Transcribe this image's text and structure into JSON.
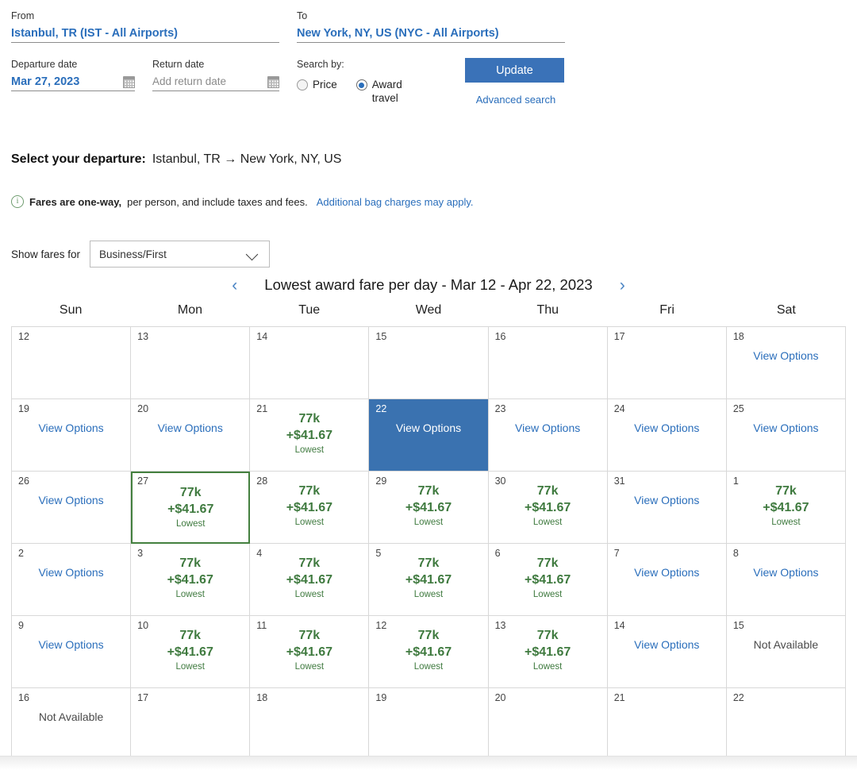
{
  "search": {
    "from_label": "From",
    "from_value": "Istanbul, TR (IST - All Airports)",
    "to_label": "To",
    "to_value": "New York, NY, US (NYC - All Airports)",
    "departure_label": "Departure date",
    "departure_value": "Mar 27, 2023",
    "return_label": "Return date",
    "return_placeholder": "Add return date",
    "search_by_label": "Search by:",
    "option_price": "Price",
    "option_award": "Award travel",
    "update_label": "Update",
    "advanced_search": "Advanced search"
  },
  "departure": {
    "heading": "Select your departure:",
    "route": "Istanbul, TR → New York, NY, US"
  },
  "note": {
    "bold": "Fares are one-way,",
    "rest": "per person, and include taxes and fees.",
    "link": "Additional bag charges may apply."
  },
  "fares_filter": {
    "label": "Show fares for",
    "selected": "Business/First"
  },
  "calendar": {
    "prev_arrow": "‹",
    "next_arrow": "›",
    "title": "Lowest award fare per day - Mar 12 - Apr 22, 2023",
    "weekdays": [
      "Sun",
      "Mon",
      "Tue",
      "Wed",
      "Thu",
      "Fri",
      "Sat"
    ],
    "labels": {
      "view_options": "View Options",
      "not_available": "Not Available",
      "lowest": "Lowest"
    },
    "colors": {
      "selected_bg": "#3a72b0",
      "chosen_border": "#44803f",
      "fare_green": "#3f7a3f",
      "link_blue": "#2a6ebb",
      "button_blue": "#3a72b8"
    },
    "cells": [
      {
        "day": "12",
        "state": "empty"
      },
      {
        "day": "13",
        "state": "empty"
      },
      {
        "day": "14",
        "state": "empty"
      },
      {
        "day": "15",
        "state": "empty"
      },
      {
        "day": "16",
        "state": "empty"
      },
      {
        "day": "17",
        "state": "empty"
      },
      {
        "day": "18",
        "state": "options"
      },
      {
        "day": "19",
        "state": "options"
      },
      {
        "day": "20",
        "state": "options"
      },
      {
        "day": "21",
        "state": "fare",
        "miles": "77k",
        "cash": "+$41.67",
        "tag": "Lowest"
      },
      {
        "day": "22",
        "state": "options",
        "selected": true
      },
      {
        "day": "23",
        "state": "options"
      },
      {
        "day": "24",
        "state": "options"
      },
      {
        "day": "25",
        "state": "options"
      },
      {
        "day": "26",
        "state": "options"
      },
      {
        "day": "27",
        "state": "fare",
        "miles": "77k",
        "cash": "+$41.67",
        "tag": "Lowest",
        "chosen": true
      },
      {
        "day": "28",
        "state": "fare",
        "miles": "77k",
        "cash": "+$41.67",
        "tag": "Lowest"
      },
      {
        "day": "29",
        "state": "fare",
        "miles": "77k",
        "cash": "+$41.67",
        "tag": "Lowest"
      },
      {
        "day": "30",
        "state": "fare",
        "miles": "77k",
        "cash": "+$41.67",
        "tag": "Lowest"
      },
      {
        "day": "31",
        "state": "options"
      },
      {
        "day": "1",
        "state": "fare",
        "miles": "77k",
        "cash": "+$41.67",
        "tag": "Lowest"
      },
      {
        "day": "2",
        "state": "options"
      },
      {
        "day": "3",
        "state": "fare",
        "miles": "77k",
        "cash": "+$41.67",
        "tag": "Lowest"
      },
      {
        "day": "4",
        "state": "fare",
        "miles": "77k",
        "cash": "+$41.67",
        "tag": "Lowest"
      },
      {
        "day": "5",
        "state": "fare",
        "miles": "77k",
        "cash": "+$41.67",
        "tag": "Lowest"
      },
      {
        "day": "6",
        "state": "fare",
        "miles": "77k",
        "cash": "+$41.67",
        "tag": "Lowest"
      },
      {
        "day": "7",
        "state": "options"
      },
      {
        "day": "8",
        "state": "options"
      },
      {
        "day": "9",
        "state": "options"
      },
      {
        "day": "10",
        "state": "fare",
        "miles": "77k",
        "cash": "+$41.67",
        "tag": "Lowest"
      },
      {
        "day": "11",
        "state": "fare",
        "miles": "77k",
        "cash": "+$41.67",
        "tag": "Lowest"
      },
      {
        "day": "12",
        "state": "fare",
        "miles": "77k",
        "cash": "+$41.67",
        "tag": "Lowest"
      },
      {
        "day": "13",
        "state": "fare",
        "miles": "77k",
        "cash": "+$41.67",
        "tag": "Lowest"
      },
      {
        "day": "14",
        "state": "options"
      },
      {
        "day": "15",
        "state": "unavailable"
      },
      {
        "day": "16",
        "state": "unavailable"
      },
      {
        "day": "17",
        "state": "empty"
      },
      {
        "day": "18",
        "state": "empty"
      },
      {
        "day": "19",
        "state": "empty"
      },
      {
        "day": "20",
        "state": "empty"
      },
      {
        "day": "21",
        "state": "empty"
      },
      {
        "day": "22",
        "state": "empty"
      }
    ]
  }
}
